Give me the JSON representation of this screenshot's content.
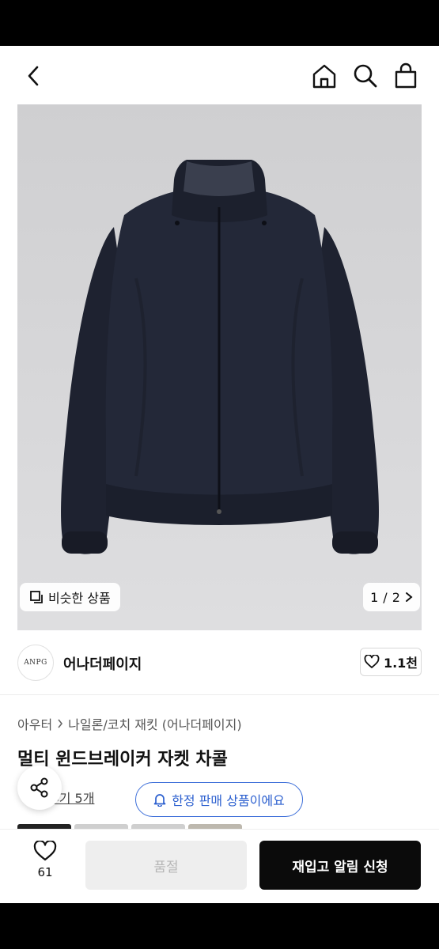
{
  "header": {
    "back_icon": "chevron-left-icon",
    "home_icon": "home-icon",
    "search_icon": "search-icon",
    "bag_icon": "shopping-bag-icon"
  },
  "gallery": {
    "similar_label": "비슷한 상품",
    "current_page": "1",
    "separator": "/",
    "total_pages": "2",
    "image_subject": "jacket"
  },
  "brand": {
    "logo_text": "ANPG",
    "name": "어나더페이지",
    "likes": "1.1천"
  },
  "product": {
    "breadcrumb_category": "아우터",
    "breadcrumb_sub": "나일론/코치 재킷 (어나더페이지)",
    "title": "멀티 윈드브레이커 자켓 차콜",
    "review_label": "후기 5개",
    "limited_label": "한정 판매 상품이에요"
  },
  "action_bar": {
    "wish_count": "61",
    "soldout_label": "품절",
    "restock_label": "재입고 알림 신청"
  },
  "colors": {
    "accent_blue": "#3d6fd9",
    "primary_button": "#0b0b0b",
    "soldout_bg": "#eeeeee"
  }
}
